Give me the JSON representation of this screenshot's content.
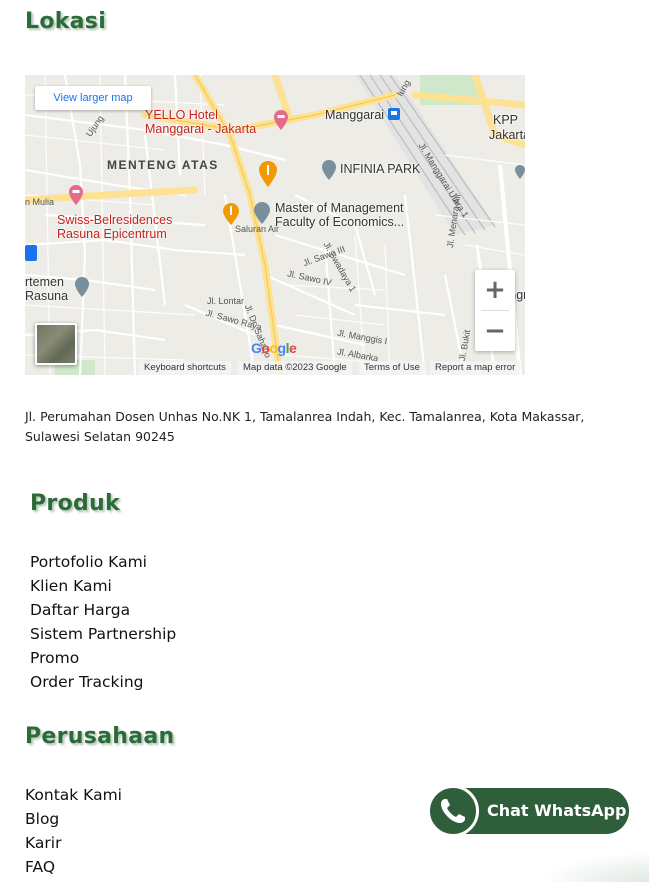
{
  "sections": {
    "lokasi_title": "Lokasi",
    "produk_title": "Produk",
    "perusahaan_title": "Perusahaan"
  },
  "map": {
    "view_larger": "View larger map",
    "zoom_in": "+",
    "zoom_out": "−",
    "google_logo": "Google",
    "keyboard_shortcuts": "Keyboard shortcuts",
    "map_data": "Map data ©2023 Google",
    "terms": "Terms of Use",
    "report": "Report a map error",
    "labels": {
      "yello_hotel_1": "YELLO Hotel",
      "yello_hotel_2": "Manggarai - Jakarta",
      "manggarai": "Manggarai",
      "menteng_atas": "MENTENG ATAS",
      "infinia_park": "INFINIA PARK",
      "swiss_1": "Swiss-Belresidences",
      "swiss_2": "Rasuna Epicentrum",
      "master_1": "Master of Management",
      "master_2": "Faculty of Economics...",
      "kpp": "KPP",
      "jakarta_ja": "Jakarta Ja",
      "shangri": "Shangri",
      "rtemen": "rtemen",
      "rasuna": "Rasuna",
      "n_mulia": "n Mulia",
      "saluran_air": "Saluran Air",
      "jl_dr_saharjo": "Jl. Dr. Saharjo",
      "jl_sawo_iii": "Jl. Sawo III",
      "jl_sawo_iv": "Jl. Sawo IV",
      "jl_swadaya": "Jl. Swadaya 1",
      "jl_lontar": "Jl. Lontar",
      "jl_sawo_raya": "Jl. Sawo Raya",
      "jl_manggis": "Jl. Manggis I",
      "jl_menara_air": "Jl. Menara Air",
      "jl_manggarai_utara": "Jl. Manggarai Utara 1",
      "jl_bukit": "Jl. Bukit",
      "ujung": "Ujung",
      "lung": "lung",
      "jl_albarka": "Jl. Albarka"
    }
  },
  "address": "Jl. Perumahan Dosen Unhas No.NK 1, Tamalanrea Indah, Kec. Tamalanrea, Kota Makassar, Sulawesi Selatan 90245",
  "produk_links": [
    "Portofolio Kami",
    "Klien Kami",
    "Daftar Harga",
    "Sistem Partnership",
    "Promo",
    "Order Tracking"
  ],
  "perusahaan_links": [
    "Kontak Kami",
    "Blog",
    "Karir",
    "FAQ"
  ],
  "whatsapp": {
    "label": "Chat WhatsApp"
  },
  "colors": {
    "heading_green": "#2d6a3a",
    "whatsapp_green": "#2e5e3a",
    "map_link_blue": "#1a73e8",
    "poi_red": "#c5221f",
    "road_yellow": "#fde293"
  }
}
